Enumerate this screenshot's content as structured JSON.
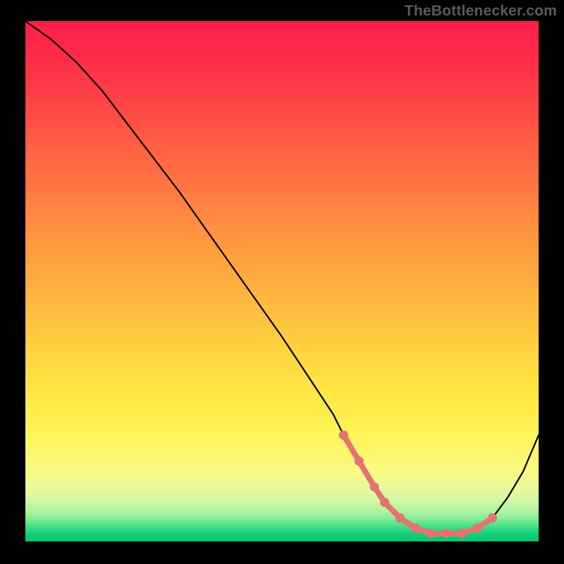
{
  "watermark": {
    "text": "TheBottlenecker.com"
  },
  "accent": {
    "marker_color": "#e57373"
  },
  "chart_data": {
    "type": "line",
    "title": "",
    "xlabel": "",
    "ylabel": "",
    "xlim": [
      0,
      100
    ],
    "ylim": [
      0,
      100
    ],
    "grid": false,
    "legend": false,
    "series": [
      {
        "name": "curve",
        "x": [
          0,
          5,
          10,
          15,
          20,
          25,
          30,
          35,
          40,
          45,
          50,
          55,
          60,
          62,
          65,
          68,
          70,
          73,
          76,
          79,
          82,
          85,
          88,
          91,
          94,
          97,
          100
        ],
        "y": [
          100,
          96.5,
          92,
          86.5,
          80,
          73.5,
          67,
          60,
          53,
          46,
          39,
          31.5,
          24,
          20,
          15,
          10,
          7,
          4,
          2,
          1,
          1,
          1,
          2,
          4,
          8,
          13,
          20
        ]
      }
    ],
    "markers": {
      "name": "highlighted-segment",
      "color": "#e57373",
      "radius_pct": 0.9,
      "line_width_pct": 1.1,
      "x": [
        62,
        65,
        68,
        70,
        73,
        76,
        79,
        82,
        85,
        88,
        91
      ],
      "y": [
        20,
        15,
        10,
        7,
        4,
        2,
        1,
        1,
        1,
        2,
        4
      ]
    },
    "background_gradient": {
      "direction": "vertical",
      "stops": [
        {
          "pct": 0,
          "color": "#ff1f4b"
        },
        {
          "pct": 8,
          "color": "#ff2e49"
        },
        {
          "pct": 16,
          "color": "#ff4646"
        },
        {
          "pct": 24,
          "color": "#ff6044"
        },
        {
          "pct": 32,
          "color": "#ff7842"
        },
        {
          "pct": 40,
          "color": "#ff9140"
        },
        {
          "pct": 48,
          "color": "#ffa83f"
        },
        {
          "pct": 56,
          "color": "#ffbf3f"
        },
        {
          "pct": 64,
          "color": "#ffd540"
        },
        {
          "pct": 72,
          "color": "#ffe846"
        },
        {
          "pct": 78,
          "color": "#fff253"
        },
        {
          "pct": 83,
          "color": "#fdf86a"
        },
        {
          "pct": 87,
          "color": "#f7fa85"
        },
        {
          "pct": 90,
          "color": "#e9f99b"
        },
        {
          "pct": 92.5,
          "color": "#d2f8a4"
        },
        {
          "pct": 94.5,
          "color": "#b0f3a0"
        },
        {
          "pct": 96,
          "color": "#86ec96"
        },
        {
          "pct": 97,
          "color": "#57e48c"
        },
        {
          "pct": 98,
          "color": "#2cda81"
        },
        {
          "pct": 99,
          "color": "#13d076"
        },
        {
          "pct": 100,
          "color": "#08c96f"
        }
      ]
    }
  }
}
